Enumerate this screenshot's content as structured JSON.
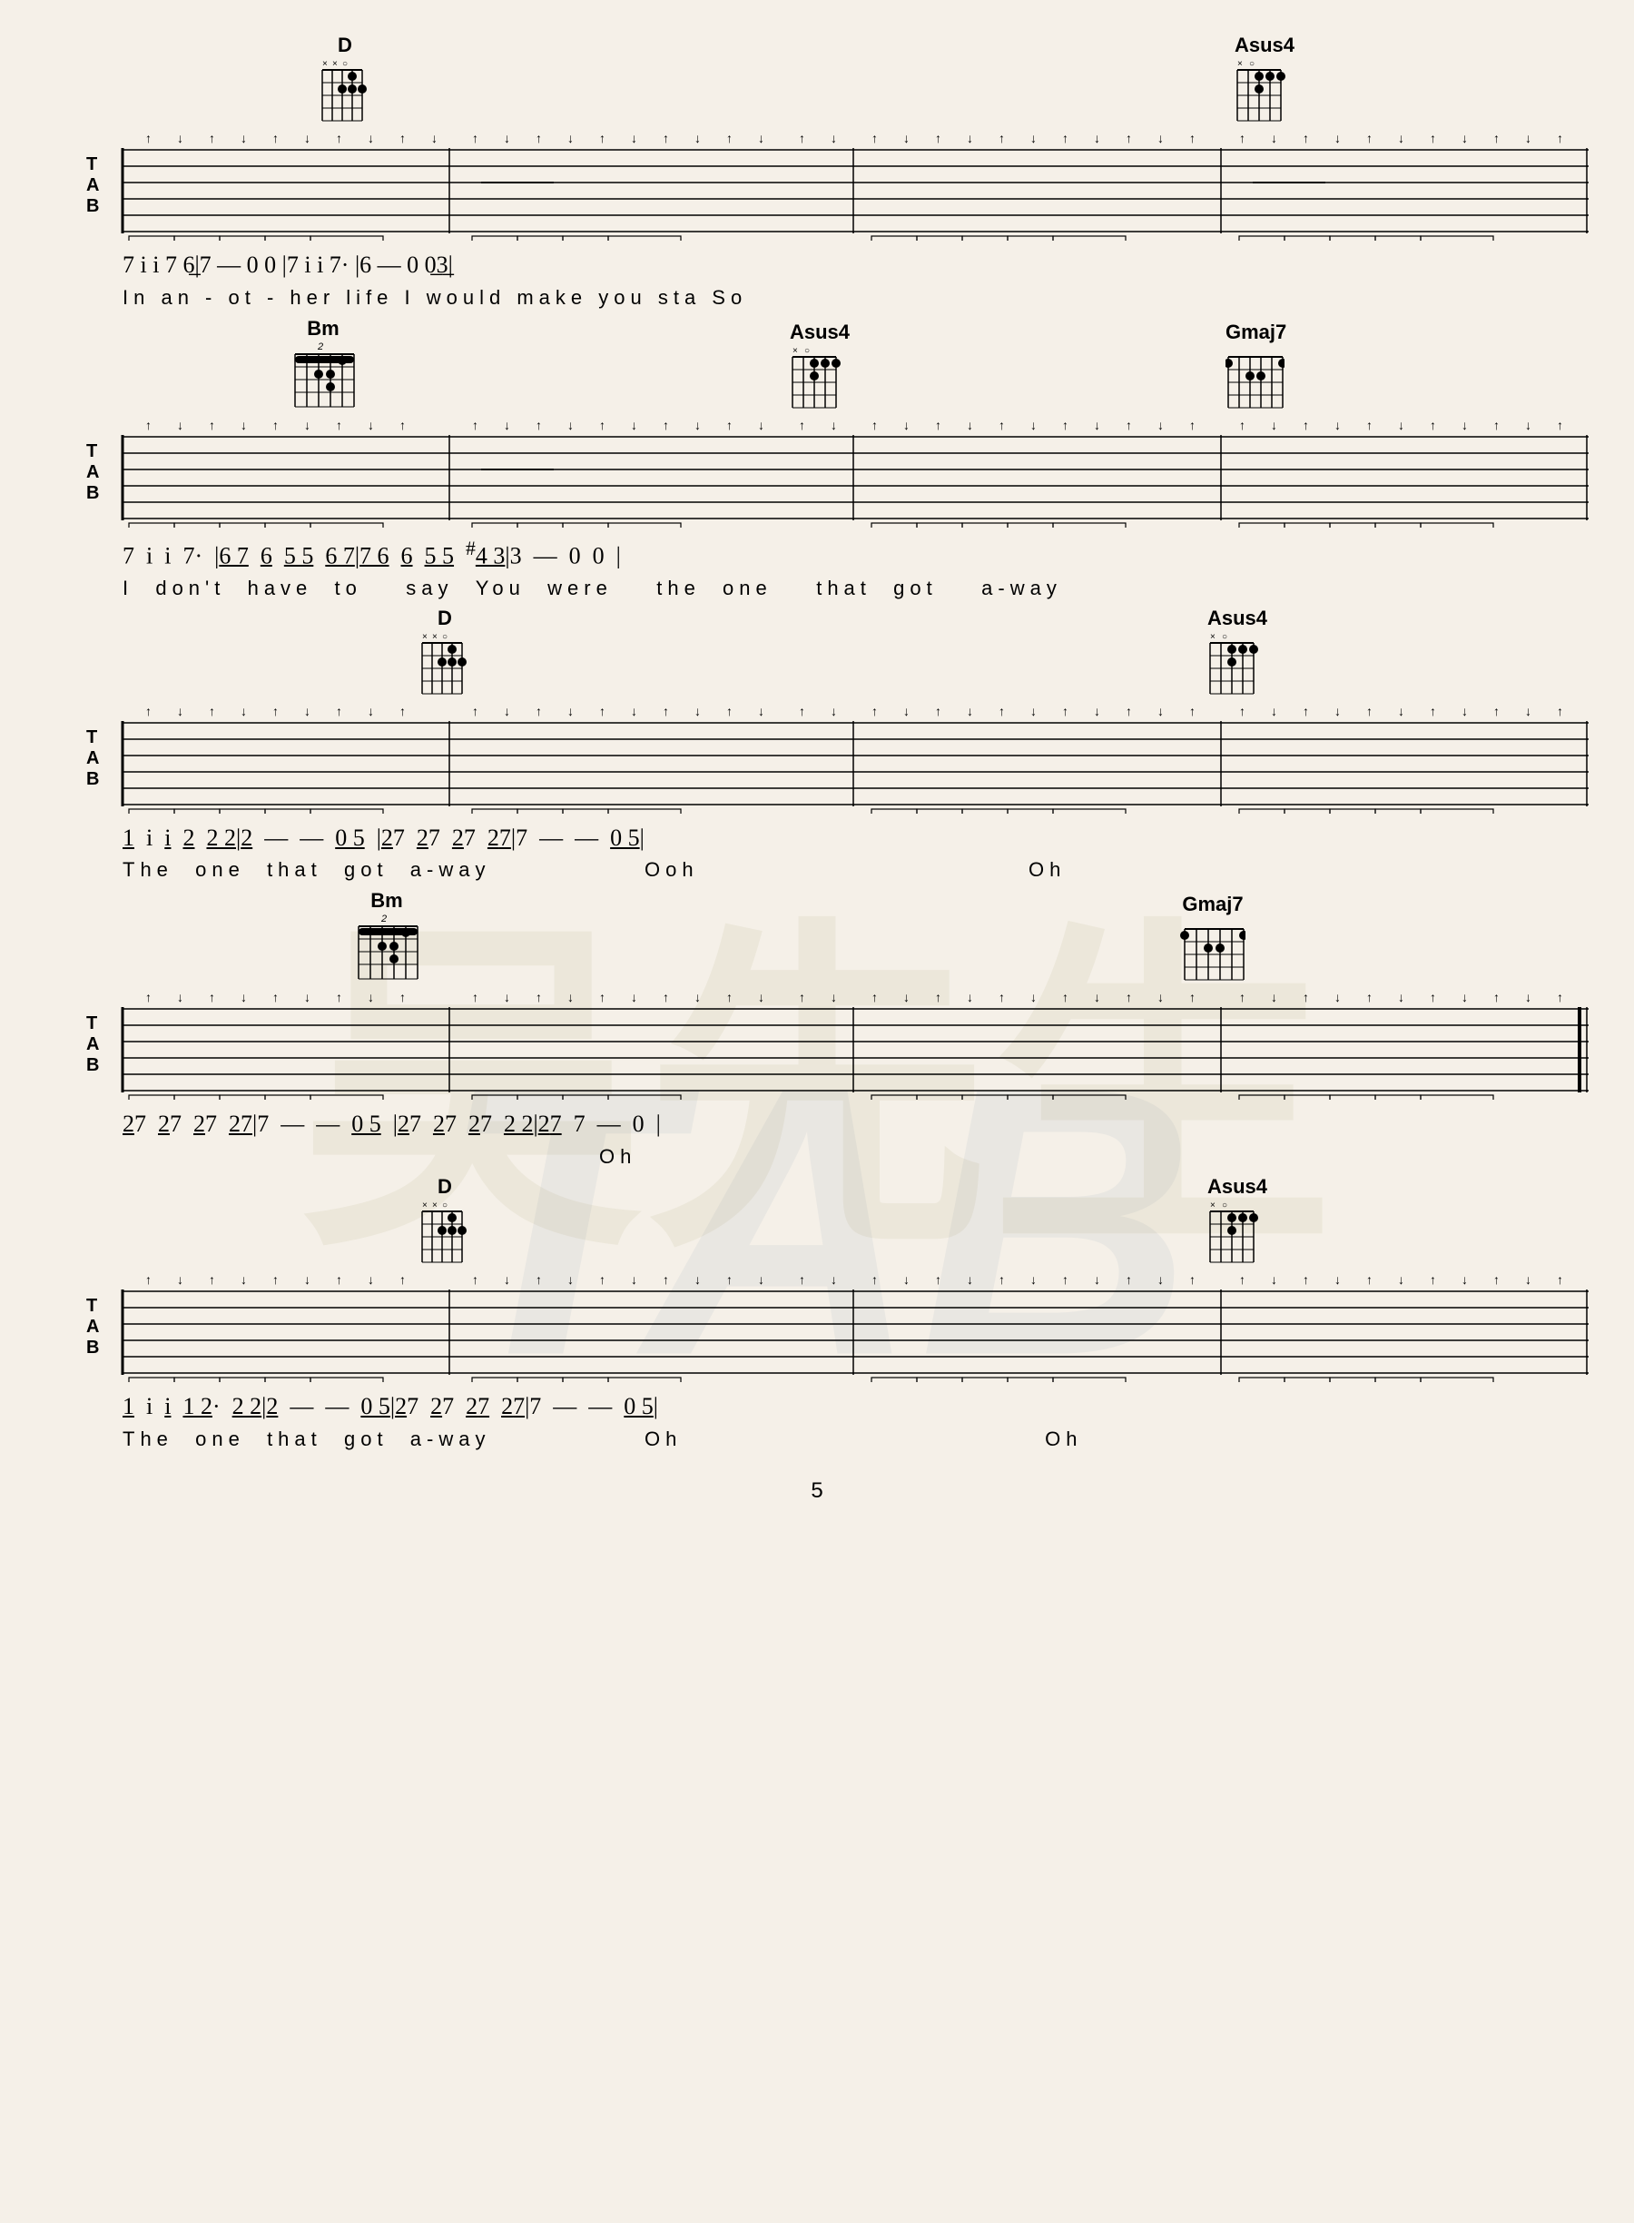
{
  "page": {
    "number": "5",
    "background_color": "#f5f0e8"
  },
  "watermark": {
    "chinese": "吴先生",
    "tab": "TAB"
  },
  "sections": [
    {
      "id": "section1",
      "chords": [
        {
          "name": "D",
          "position_pct": 18,
          "fret_marker": "××○",
          "fret_start": null
        },
        {
          "name": "Asus4",
          "position_pct": 75,
          "fret_marker": "×○",
          "fret_start": null
        }
      ],
      "notation": "7  i  i  7  6̲|7  —  0  0  |7  i  i  7·  |6  —  0  0̲3̲|",
      "lyrics": "In  an - ot - her  life               I  would  make  you  sta          So"
    },
    {
      "id": "section2",
      "chords": [
        {
          "name": "Bm",
          "position_pct": 18,
          "fret_marker": "2",
          "fret_start": 2
        },
        {
          "name": "Asus4",
          "position_pct": 48,
          "fret_marker": "×○",
          "fret_start": null
        },
        {
          "name": "Gmaj7",
          "position_pct": 76,
          "fret_marker": "",
          "fret_start": null
        }
      ],
      "notation": "7  i  i  7·  |6̲7̲  6̲  5̲5̲  6̲7̲|7̲6̲  6̲  5̲5̲  #4̲3̲|3  —  0  0  |",
      "lyrics": "I  don't  have  to    say  You  were    the  one    that  got    a-way"
    },
    {
      "id": "section3",
      "chords": [
        {
          "name": "D",
          "position_pct": 26,
          "fret_marker": "××○",
          "fret_start": null
        },
        {
          "name": "Asus4",
          "position_pct": 75,
          "fret_marker": "×○",
          "fret_start": null
        }
      ],
      "notation": "1̣  i  ị  2̣  2̣2̣|2̣  —  —  0̣5̣  |2̣7  2̣7  2̣7  2̣7̲|7  —  —  0̣5̣|",
      "lyrics": "The  one  that  got  a-way               Ooh                              Oh"
    },
    {
      "id": "section4",
      "chords": [
        {
          "name": "Bm",
          "position_pct": 21,
          "fret_marker": "2",
          "fret_start": 2
        },
        {
          "name": "Gmaj7",
          "position_pct": 73,
          "fret_marker": "",
          "fret_start": null
        }
      ],
      "notation": "2̣7  2̣7  2̣7  2̣7̲|7  —  —  0̣5̣  |2̣7  2̣7  2̣7  2̣2̣|2̣7̲  7  —  0  |",
      "lyrics": "                                          Oh"
    },
    {
      "id": "section5",
      "chords": [
        {
          "name": "D",
          "position_pct": 26,
          "fret_marker": "××○",
          "fret_start": null
        },
        {
          "name": "Asus4",
          "position_pct": 75,
          "fret_marker": "×○",
          "fret_start": null
        }
      ],
      "notation": "1̣  i  ị  1̣2̣·  2̣2̣|2̣  —  —  0̣5̣|2̣7  2̣7  2̣7̲  2̣7̲|7  —  —  0̣5̣|",
      "lyrics": "The  one  that  got  a-way               Oh                               Oh"
    }
  ]
}
